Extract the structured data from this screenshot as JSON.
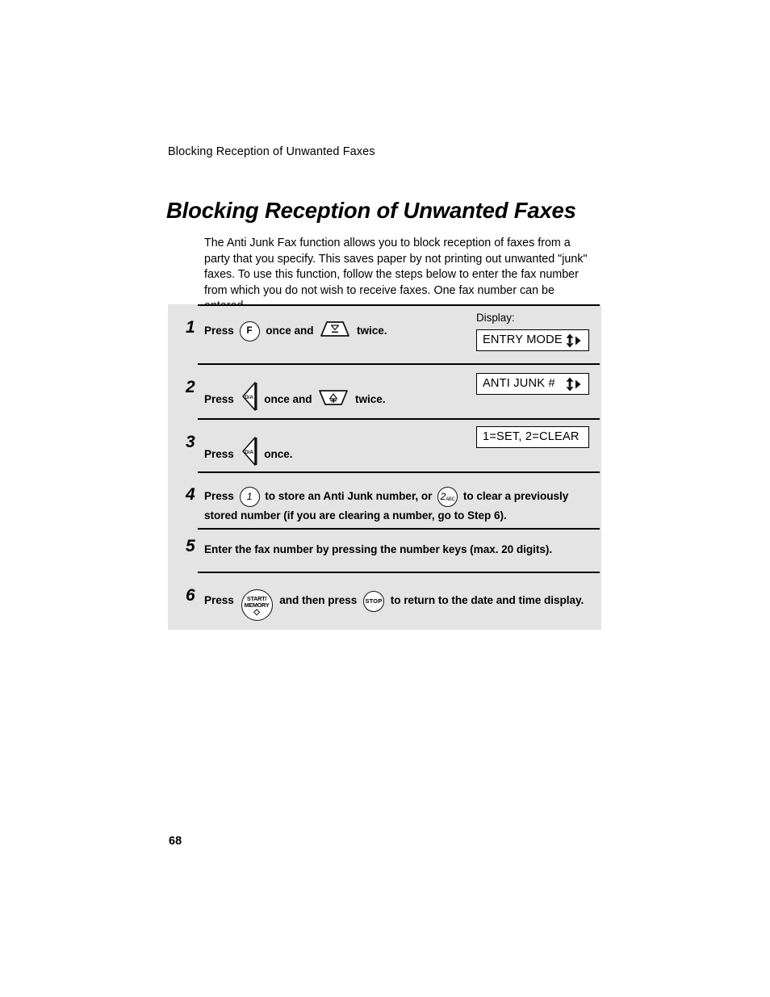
{
  "page": {
    "running_header": "Blocking Reception of Unwanted Faxes",
    "title": "Blocking Reception of Unwanted Faxes",
    "page_number": "68"
  },
  "intro": {
    "paragraph": "The Anti Junk Fax function allows you to block reception of faxes from a party that you specify. This saves paper by not printing out unwanted \"junk\" faxes. To use this function, follow the steps below to enter the fax number from which you do not wish to receive faxes. One fax number can be entered."
  },
  "display_column": {
    "label": "Display:",
    "boxes": [
      {
        "text": "ENTRY MODE",
        "indicator": "up-down-right-arrows"
      },
      {
        "text": "ANTI JUNK #",
        "indicator": "up-down-right-arrows"
      },
      {
        "text": "1=SET, 2=CLEAR",
        "indicator": "none"
      }
    ]
  },
  "steps": [
    {
      "number": "1",
      "text_before": "Press",
      "key1": "F",
      "text_middle": "once and",
      "key2": "down-arrow-key",
      "text_after": "twice."
    },
    {
      "number": "2",
      "text_before": "Press",
      "key1": "function-set-key",
      "text_middle": "once and",
      "key2": "up-arrow-key",
      "text_after": "twice."
    },
    {
      "number": "3",
      "text_before": "Press",
      "key1": "function-set-key",
      "text_after": "once."
    },
    {
      "number": "4",
      "text_before": "Press",
      "key1": "1",
      "text_middle": "to store an Anti Junk number, or",
      "key2": "2",
      "key2_sub": "ABC",
      "text_after": "to clear a previously",
      "line2": "stored number (if you are clearing a number, go to Step 6)."
    },
    {
      "number": "5",
      "text_full": "Enter the fax number by pressing the number keys (max. 20 digits)."
    },
    {
      "number": "6",
      "text_before": "Press",
      "key1_line1": "START/",
      "key1_line2": "MEMORY",
      "text_middle": "and then press",
      "key2": "STOP",
      "text_after": "to return to the date and time display."
    }
  ],
  "colors": {
    "panel_background": "#e4e4e4",
    "page_background": "#ffffff",
    "ink": "#000000"
  }
}
